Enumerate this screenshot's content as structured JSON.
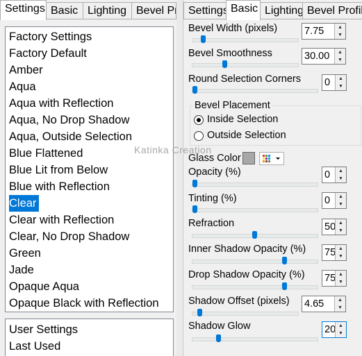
{
  "left_tabs": [
    {
      "label": "Settings",
      "active": true
    },
    {
      "label": "Basic",
      "active": false
    },
    {
      "label": "Lighting",
      "active": false
    },
    {
      "label": "Bevel Pr",
      "active": false
    }
  ],
  "factory_list": [
    "Factory Settings",
    "Factory Default",
    "Amber",
    "Aqua",
    "Aqua with Reflection",
    "Aqua, No Drop Shadow",
    "Aqua, Outside Selection",
    "Blue Flattened",
    "Blue Lit from Below",
    "Blue with Reflection",
    "Clear",
    "Clear with Reflection",
    "Clear, No Drop Shadow",
    "Green",
    "Jade",
    "Opaque Aqua",
    "Opaque Black with Reflection"
  ],
  "selected_item": "Clear",
  "user_list": [
    "User Settings",
    "Last Used"
  ],
  "right_tabs": [
    {
      "label": "Settings",
      "active": false
    },
    {
      "label": "Basic",
      "active": true
    },
    {
      "label": "Lighting",
      "active": false
    },
    {
      "label": "Bevel Profile",
      "active": false
    }
  ],
  "controls": {
    "bevel_width": {
      "label": "Bevel Width (pixels)",
      "value": "7.75",
      "level": 0.08
    },
    "bevel_smoothness": {
      "label": "Bevel Smoothness",
      "value": "30.00",
      "level": 0.3
    },
    "round_corners": {
      "label": "Round Selection Corners",
      "value": "0",
      "level": 0.0
    },
    "opacity": {
      "label": "Opacity (%)",
      "value": "0",
      "level": 0.0
    },
    "tinting": {
      "label": "Tinting (%)",
      "value": "0",
      "level": 0.0
    },
    "refraction": {
      "label": "Refraction",
      "value": "50",
      "level": 0.5
    },
    "inner_shadow": {
      "label": "Inner Shadow Opacity (%)",
      "value": "75",
      "level": 0.75
    },
    "drop_shadow": {
      "label": "Drop Shadow Opacity (%)",
      "value": "75",
      "level": 0.75
    },
    "shadow_offset": {
      "label": "Shadow Offset (pixels)",
      "value": "4.65",
      "level": 0.05
    },
    "shadow_glow": {
      "label": "Shadow Glow",
      "value": "20",
      "level": 0.2
    }
  },
  "bevel_placement": {
    "title": "Bevel Placement",
    "options": [
      {
        "label": "Inside Selection",
        "checked": true
      },
      {
        "label": "Outside Selection",
        "checked": false
      }
    ]
  },
  "glass_color": {
    "label": "Glass Color",
    "color": "#a8a8a8"
  },
  "watermark": "Katinka Creation",
  "colors": {
    "selection": "#0078d7",
    "slider_thumb": "#0078d7"
  }
}
